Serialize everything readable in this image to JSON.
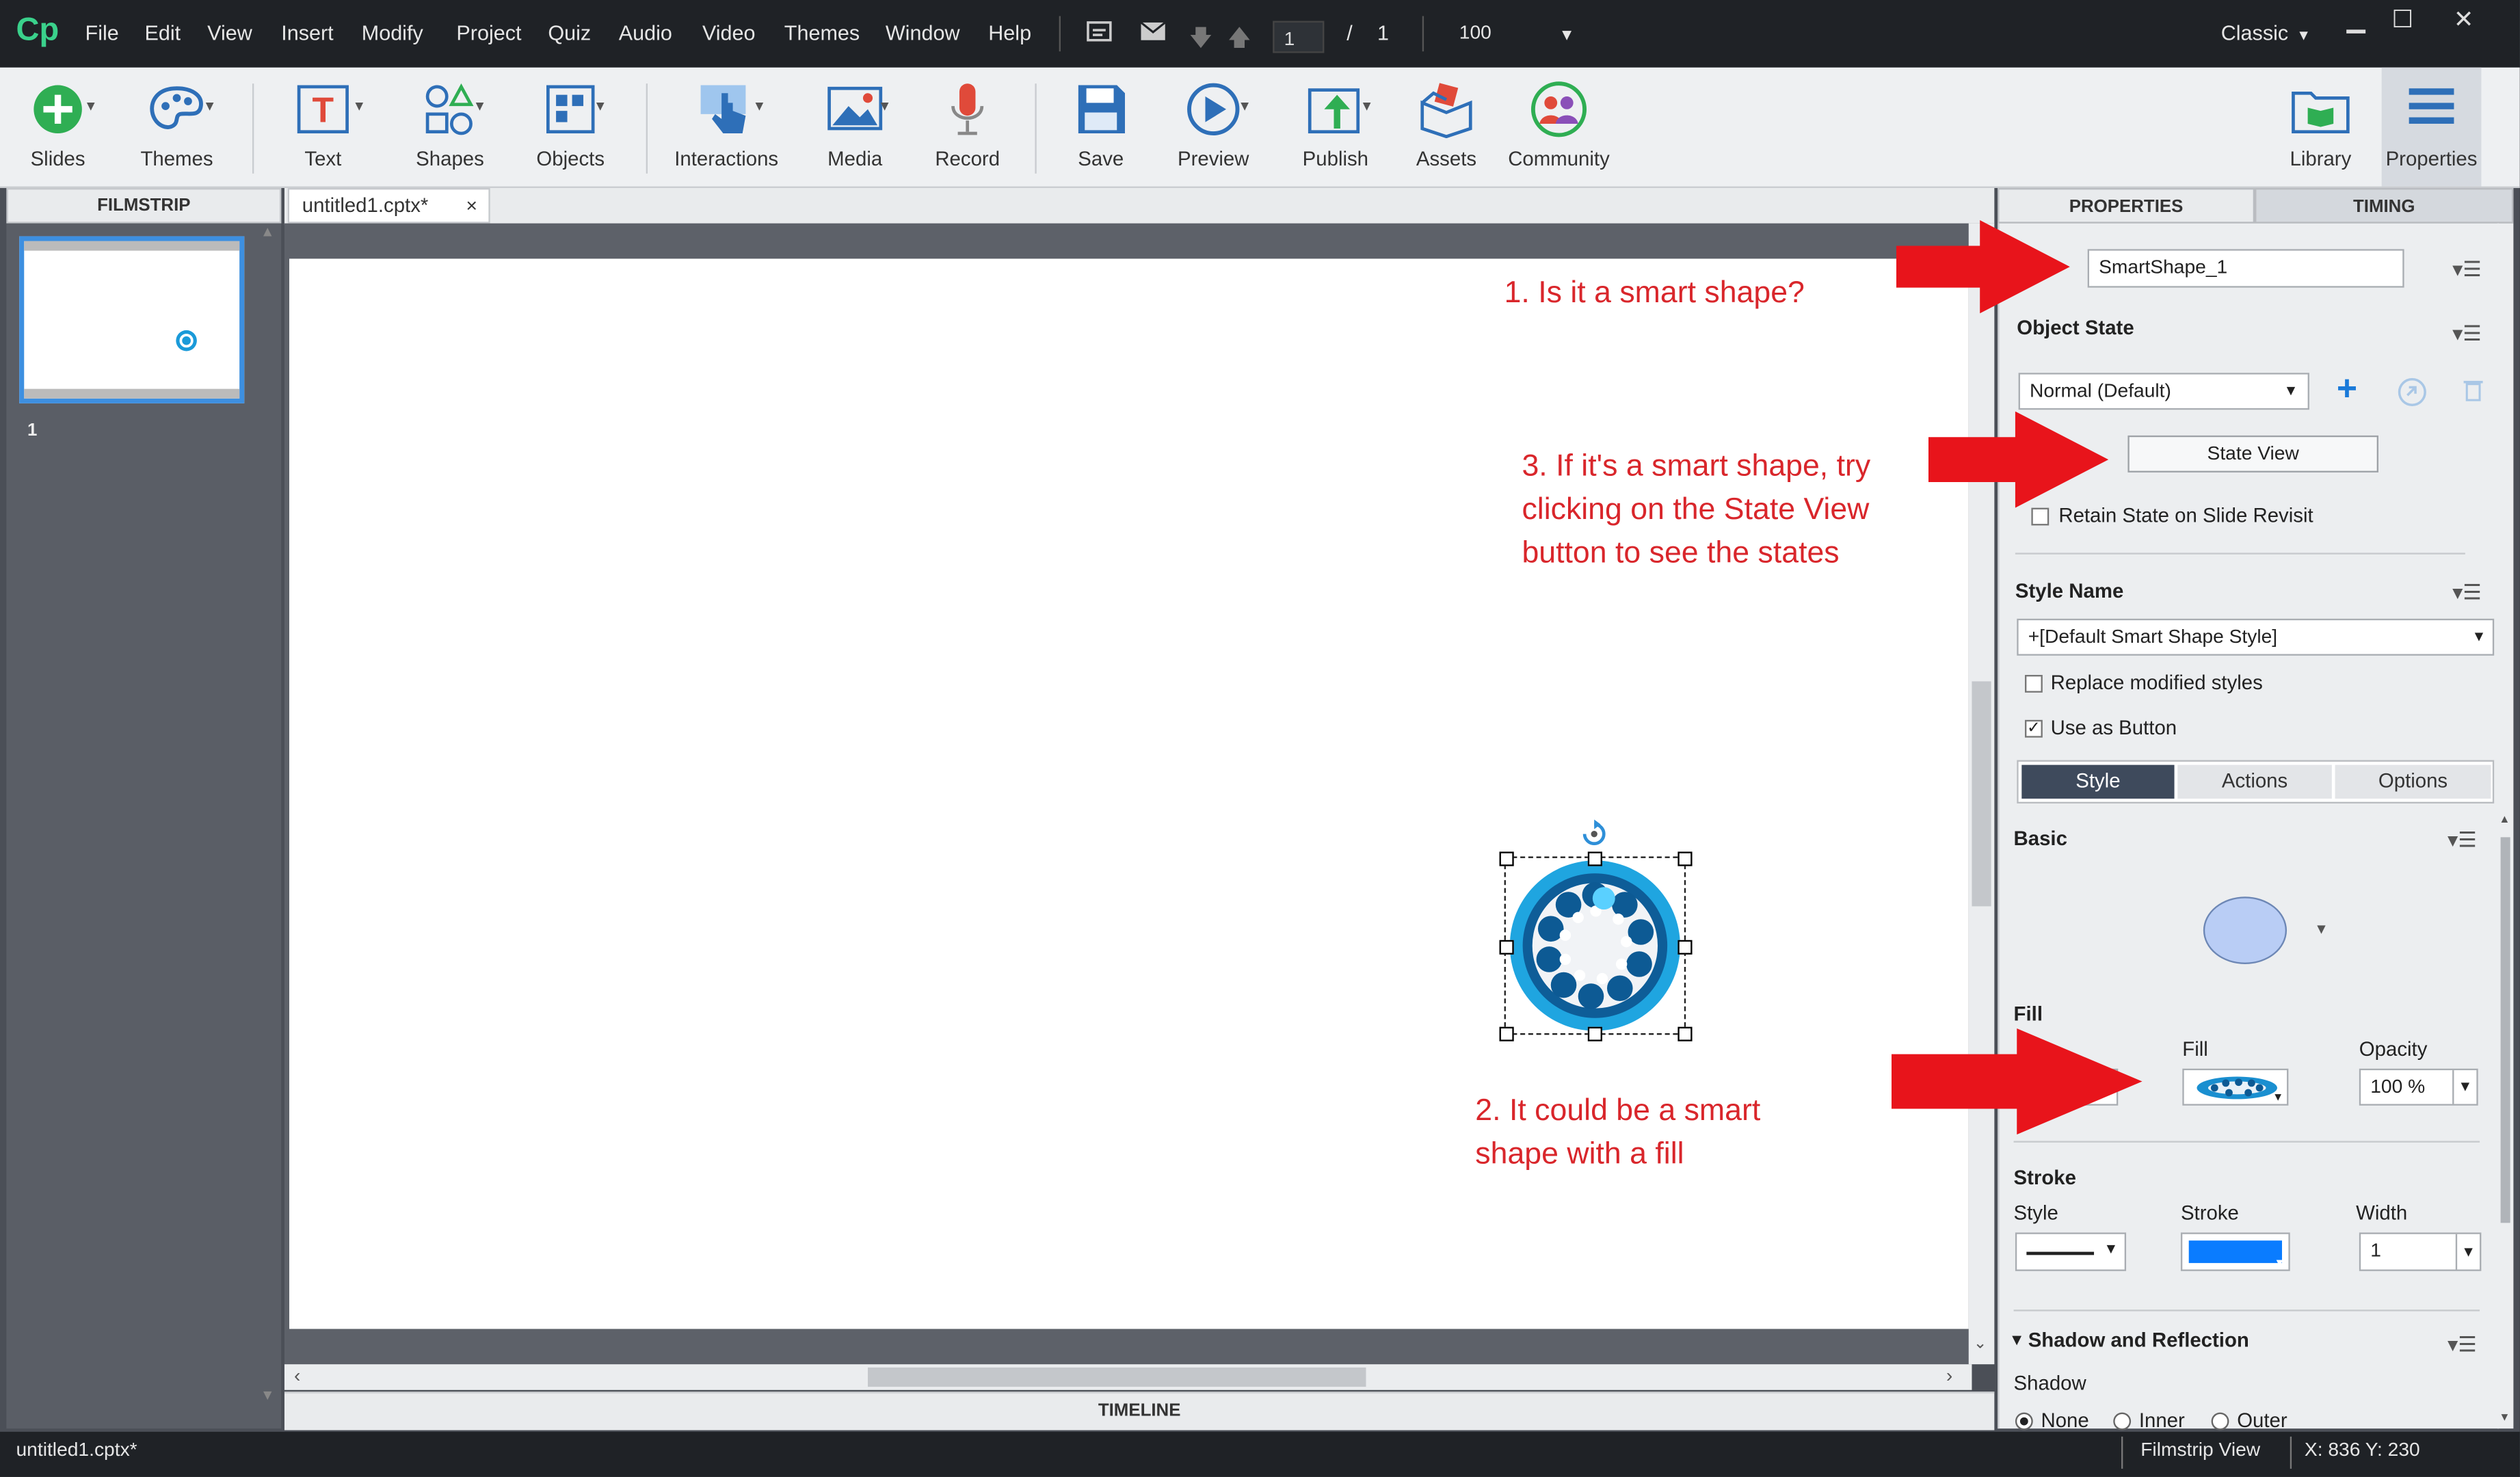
{
  "app": {
    "logo": "Cp",
    "menu": [
      "File",
      "Edit",
      "View",
      "Insert",
      "Modify",
      "Project",
      "Quiz",
      "Audio",
      "Video",
      "Themes",
      "Window",
      "Help"
    ],
    "slide_current": "1",
    "slide_sep": "/",
    "slide_total": "1",
    "zoom": "100",
    "workspace": "Classic"
  },
  "toolbar": {
    "slides": "Slides",
    "themes": "Themes",
    "text": "Text",
    "shapes": "Shapes",
    "objects": "Objects",
    "interactions": "Interactions",
    "media": "Media",
    "record": "Record",
    "save": "Save",
    "preview": "Preview",
    "publish": "Publish",
    "assets": "Assets",
    "community": "Community",
    "library": "Library",
    "properties": "Properties"
  },
  "filmstrip": {
    "title": "FILMSTRIP",
    "slide_number": "1"
  },
  "document": {
    "tab_title": "untitled1.cptx*"
  },
  "timeline": {
    "title": "TIMELINE"
  },
  "panel": {
    "tab_properties": "PROPERTIES",
    "tab_timing": "TIMING",
    "object_name": "SmartShape_1",
    "object_state_label": "Object State",
    "state_value": "Normal (Default)",
    "state_view_button": "State View",
    "retain_state_label": "Retain State on Slide Revisit",
    "style_name_label": "Style Name",
    "style_name_value": "+[Default Smart Shape Style]",
    "replace_styles_label": "Replace modified styles",
    "use_as_button_label": "Use as Button",
    "subtabs": [
      "Style",
      "Actions",
      "Options"
    ],
    "basic_label": "Basic",
    "fill_section": "Fill",
    "fill_label": "Fill",
    "opacity_label": "Opacity",
    "opacity_value": "100 %",
    "stroke_section": "Stroke",
    "stroke_style_label": "Style",
    "stroke_label": "Stroke",
    "width_label": "Width",
    "width_value": "1",
    "shadow_section": "Shadow and Reflection",
    "shadow_label": "Shadow",
    "shadow_options": [
      "None",
      "Inner",
      "Outer"
    ],
    "colors": {
      "stroke_color": "#0a7cff",
      "shape_fill": "#b9cdf5"
    }
  },
  "annotations": {
    "note1": "1.  Is it a smart shape?",
    "note2_line1": "2. It could be a smart",
    "note2_line2": "shape with a fill",
    "note3_line1": "3. If it's a smart shape, try",
    "note3_line2": "clicking on the State View",
    "note3_line3": "button to see the states"
  },
  "statusbar": {
    "filename": "untitled1.cptx*",
    "view": "Filmstrip View",
    "coords": "X: 836 Y: 230"
  }
}
